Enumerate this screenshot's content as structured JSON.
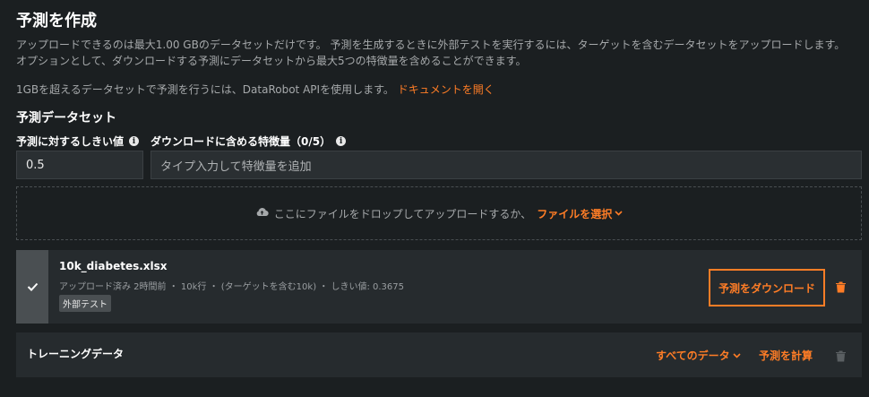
{
  "header": {
    "title": "予測を作成",
    "description_line1": "アップロードできるのは最大1.00 GBのデータセットだけです。 予測を生成するときに外部テストを実行するには、ターゲットを含むデータセットをアップロードします。",
    "description_line2": "オプションとして、ダウンロードする予測にデータセットから最大5つの特徴量を含めることができます。",
    "api_note": "1GBを超えるデータセットで予測を行うには、DataRobot APIを使用します。",
    "docs_link": "ドキュメントを開く"
  },
  "dataset_section": {
    "title": "予測データセット",
    "threshold_label": "予測に対するしきい値",
    "threshold_value": "0.5",
    "features_label": "ダウンロードに含める特徴量（0/5）",
    "features_placeholder": "タイプ入力して特徴量を追加"
  },
  "dropzone": {
    "text": "ここにファイルをドロップしてアップロードするか、",
    "choose_file": "ファイルを選択"
  },
  "uploaded_file": {
    "name": "10k_diabetes.xlsx",
    "meta": "アップロード済み 2時間前 ・ 10k行 ・ (ターゲットを含む10k) ・ しきい値: 0.3675",
    "tag": "外部テスト",
    "download_button": "予測をダウンロード"
  },
  "training": {
    "title": "トレーニングデータ",
    "all_data": "すべてのデータ",
    "compute": "予測を計算"
  },
  "colors": {
    "accent": "#ff7d26",
    "background": "#1b1f21",
    "card": "#262b2e"
  },
  "icons": [
    "info-icon",
    "cloud-upload-icon",
    "chevron-down-icon",
    "check-icon",
    "trash-icon"
  ]
}
